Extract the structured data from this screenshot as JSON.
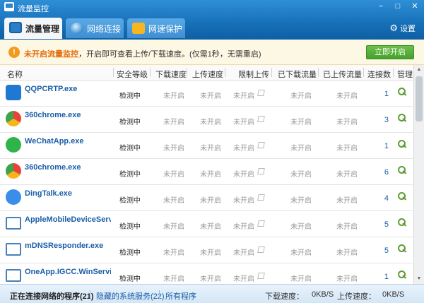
{
  "window": {
    "title": "流量监控",
    "controls": [
      "−",
      "□",
      "✕"
    ]
  },
  "tabs": [
    {
      "label": "流量管理",
      "icon": "traffic-monitor-icon",
      "active": true
    },
    {
      "label": "网络连接",
      "icon": "globe-icon",
      "active": false
    },
    {
      "label": "网速保护",
      "icon": "speed-protect-icon",
      "active": false
    }
  ],
  "settings": {
    "label": "设置",
    "icon": "gear-icon"
  },
  "notice": {
    "icon": "warning-icon",
    "strong": "未开启流量监控",
    "text": "，开启即可查看上传/下载速度。(仅需1秒，无需重启)",
    "button": "立即开启"
  },
  "columns": [
    "名称",
    "安全等级",
    "下载速度",
    "上传速度",
    "限制上传",
    "已下载流量",
    "已上传流量",
    "连接数",
    "管理"
  ],
  "rows": [
    {
      "name": "QQPCRTP.exe",
      "icon": "qq-pc-manager-icon",
      "security": "检测中",
      "download": "未开启",
      "upload": "未开启",
      "limit": "未开启",
      "downloaded": "未开启",
      "uploaded": "未开启",
      "connections": "1"
    },
    {
      "name": "360chrome.exe",
      "icon": "360-chrome-icon",
      "security": "检测中",
      "download": "未开启",
      "upload": "未开启",
      "limit": "未开启",
      "downloaded": "未开启",
      "uploaded": "未开启",
      "connections": "3"
    },
    {
      "name": "WeChatApp.exe",
      "icon": "wechat-app-icon",
      "security": "检测中",
      "download": "未开启",
      "upload": "未开启",
      "limit": "未开启",
      "downloaded": "未开启",
      "uploaded": "未开启",
      "connections": "1"
    },
    {
      "name": "360chrome.exe",
      "icon": "360-chrome-icon",
      "security": "检测中",
      "download": "未开启",
      "upload": "未开启",
      "limit": "未开启",
      "downloaded": "未开启",
      "uploaded": "未开启",
      "connections": "6"
    },
    {
      "name": "DingTalk.exe",
      "icon": "dingtalk-icon",
      "security": "检测中",
      "download": "未开启",
      "upload": "未开启",
      "limit": "未开启",
      "downloaded": "未开启",
      "uploaded": "未开启",
      "connections": "4"
    },
    {
      "name": "AppleMobileDeviceServi...",
      "icon": "service-window-icon",
      "security": "检测中",
      "download": "未开启",
      "upload": "未开启",
      "limit": "未开启",
      "downloaded": "未开启",
      "uploaded": "未开启",
      "connections": "5"
    },
    {
      "name": "mDNSResponder.exe",
      "icon": "service-window-icon",
      "security": "检测中",
      "download": "未开启",
      "upload": "未开启",
      "limit": "未开启",
      "downloaded": "未开启",
      "uploaded": "未开启",
      "connections": "5"
    },
    {
      "name": "OneApp.IGCC.WinServic...",
      "icon": "service-window-icon",
      "security": "检测中",
      "download": "未开启",
      "upload": "未开启",
      "limit": "未开启",
      "downloaded": "未开启",
      "uploaded": "未开启",
      "connections": "1"
    }
  ],
  "status": {
    "active": "正在连接网络的程序(21)",
    "hidden": "隐藏的系统服务(22)",
    "all": "所有程序",
    "download_label": "下载速度：",
    "download_value": "0KB/S",
    "upload_label": "上传速度：",
    "upload_value": "0KB/S"
  },
  "colors": {
    "header": "#1670b8",
    "link": "#1a5fa8",
    "button": "#45a12b",
    "warning": "#f39a1e"
  }
}
